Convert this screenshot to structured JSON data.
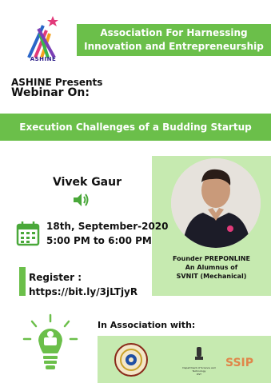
{
  "logo": {
    "text": "ASHINE"
  },
  "top_banner": {
    "line1": "Association For Harnessing",
    "line2": "Innovation and Entrepreneurship"
  },
  "intro": {
    "presents": "ASHINE Presents",
    "webinar": "Webinar On:"
  },
  "title_banner": {
    "text": "Execution Challenges of a Budding Startup"
  },
  "speaker": {
    "name": "Vivek Gaur",
    "role_line1": "Founder PREPONLINE",
    "role_line2": "An Alumnus of",
    "role_line3": "SVNIT (Mechanical)"
  },
  "schedule": {
    "date": "18th, September-2020",
    "time": "5:00 PM to 6:00 PM"
  },
  "register": {
    "label": "Register :",
    "link": "https://bit.ly/3jLTjyR"
  },
  "association": {
    "heading": "In Association with:",
    "dst_line1": "Department of Science and Technology",
    "dst_line2": "DST",
    "ssip": "SSIP"
  },
  "colors": {
    "accent_green": "#6bbf4a",
    "light_green": "#c6eab0"
  },
  "icons": [
    "ashine-logo-icon",
    "speaker-icon",
    "calendar-icon",
    "lightbulb-icon",
    "emblem-icon",
    "dst-emblem-icon"
  ]
}
